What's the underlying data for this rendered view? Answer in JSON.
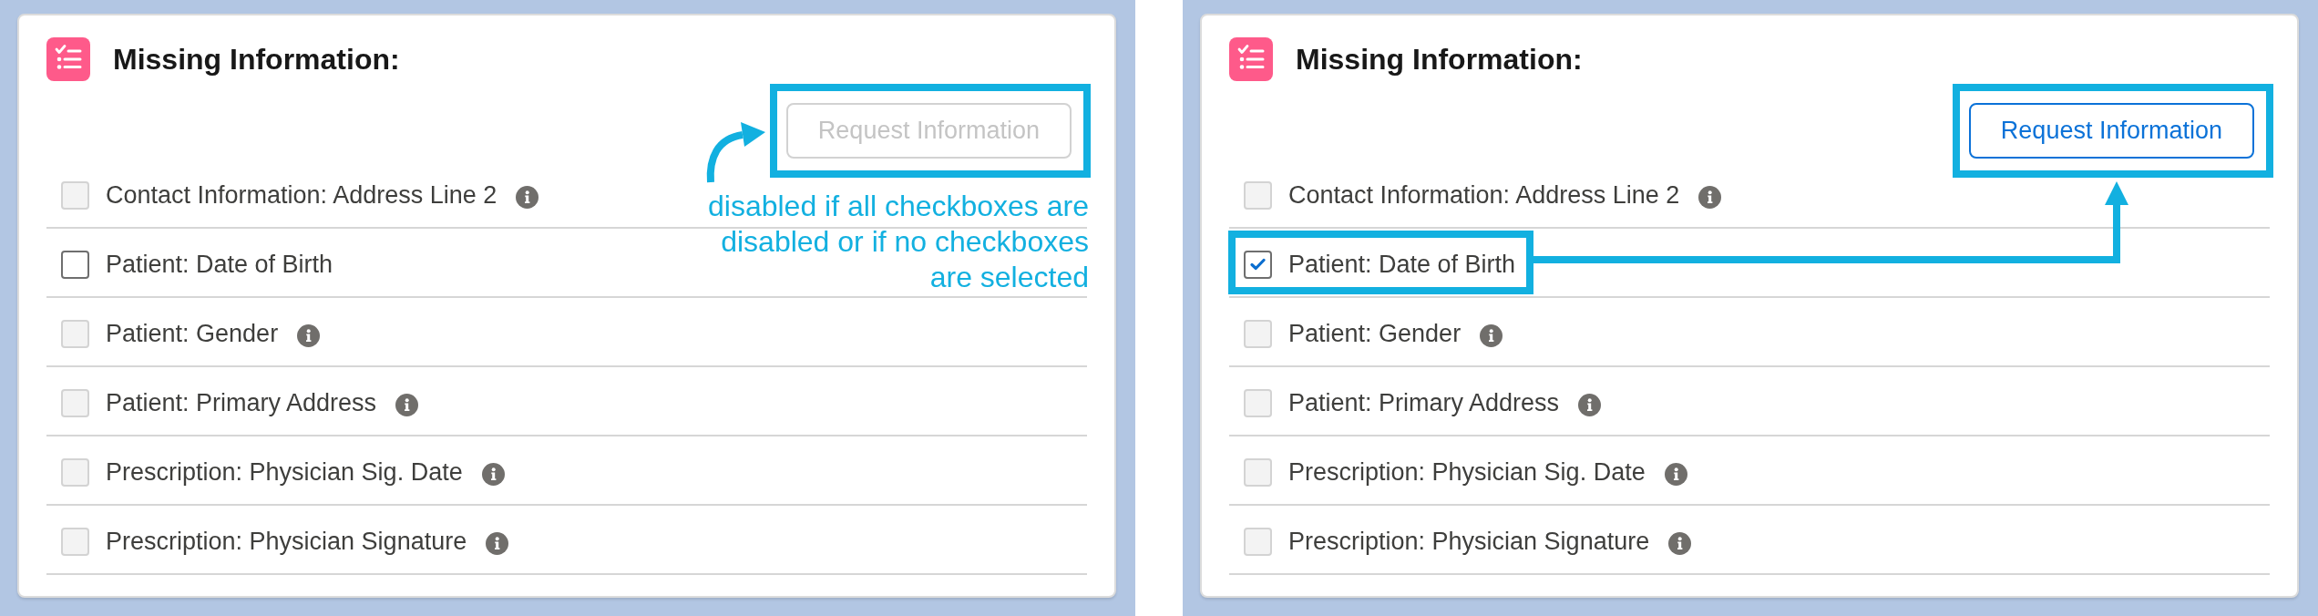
{
  "panels": [
    {
      "title": "Missing Information:",
      "request_button": {
        "label": "Request Information",
        "disabled": true,
        "highlighted": true
      },
      "annotation": {
        "kind": "note",
        "text": "disabled if all checkboxes are disabled or if no checkboxes are selected"
      },
      "items": [
        {
          "label": "Contact Information: Address Line 2",
          "checked": false,
          "disabled": true,
          "info_icon": true,
          "highlighted": false
        },
        {
          "label": "Patient: Date of Birth",
          "checked": false,
          "disabled": false,
          "info_icon": false,
          "highlighted": false
        },
        {
          "label": "Patient: Gender",
          "checked": false,
          "disabled": true,
          "info_icon": true,
          "highlighted": false
        },
        {
          "label": "Patient: Primary Address",
          "checked": false,
          "disabled": true,
          "info_icon": true,
          "highlighted": false
        },
        {
          "label": "Prescription: Physician Sig. Date",
          "checked": false,
          "disabled": true,
          "info_icon": true,
          "highlighted": false
        },
        {
          "label": "Prescription: Physician Signature",
          "checked": false,
          "disabled": true,
          "info_icon": true,
          "highlighted": false
        }
      ]
    },
    {
      "title": "Missing Information:",
      "request_button": {
        "label": "Request Information",
        "disabled": false,
        "highlighted": true
      },
      "annotation": {
        "kind": "connector"
      },
      "items": [
        {
          "label": "Contact Information: Address Line 2",
          "checked": false,
          "disabled": true,
          "info_icon": true,
          "highlighted": false
        },
        {
          "label": "Patient: Date of Birth",
          "checked": true,
          "disabled": false,
          "info_icon": false,
          "highlighted": true
        },
        {
          "label": "Patient: Gender",
          "checked": false,
          "disabled": true,
          "info_icon": true,
          "highlighted": false
        },
        {
          "label": "Patient: Primary Address",
          "checked": false,
          "disabled": true,
          "info_icon": true,
          "highlighted": false
        },
        {
          "label": "Prescription: Physician Sig. Date",
          "checked": false,
          "disabled": true,
          "info_icon": true,
          "highlighted": false
        },
        {
          "label": "Prescription: Physician Signature",
          "checked": false,
          "disabled": true,
          "info_icon": true,
          "highlighted": false
        }
      ]
    }
  ]
}
